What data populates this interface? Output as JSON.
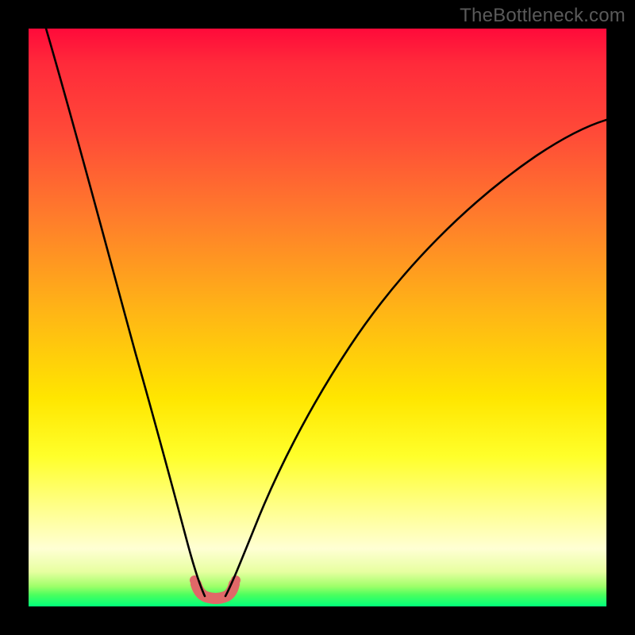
{
  "watermark": {
    "text": "TheBottleneck.com"
  },
  "chart_data": {
    "type": "line",
    "title": "",
    "xlabel": "",
    "ylabel": "",
    "xlim": [
      0,
      100
    ],
    "ylim": [
      0,
      100
    ],
    "grid": false,
    "legend": false,
    "background_gradient": {
      "direction": "vertical",
      "stops": [
        {
          "pos": 0.0,
          "color": "#ff0a3a"
        },
        {
          "pos": 0.18,
          "color": "#ff4a38"
        },
        {
          "pos": 0.48,
          "color": "#ffb217"
        },
        {
          "pos": 0.74,
          "color": "#ffff2a"
        },
        {
          "pos": 0.9,
          "color": "#ffffd4"
        },
        {
          "pos": 0.97,
          "color": "#9fff6a"
        },
        {
          "pos": 1.0,
          "color": "#00ff7a"
        }
      ]
    },
    "series": [
      {
        "name": "left-branch",
        "x": [
          3,
          8,
          13,
          18,
          21,
          24,
          26,
          28,
          29.5,
          30.5
        ],
        "y": [
          100,
          83,
          64,
          44,
          31,
          20,
          12,
          6,
          2.5,
          1.0
        ]
      },
      {
        "name": "right-branch",
        "x": [
          34,
          36,
          38.5,
          42,
          47,
          54,
          63,
          74,
          86,
          100
        ],
        "y": [
          1.0,
          3,
          7,
          14,
          24,
          37,
          51,
          63,
          74,
          84
        ]
      }
    ],
    "highlight": {
      "name": "minimum-region",
      "x": [
        29,
        30,
        31,
        32,
        33,
        34,
        35
      ],
      "y": [
        3.0,
        1.2,
        0.6,
        0.5,
        0.7,
        1.4,
        3.2
      ],
      "color": "#e06868"
    }
  }
}
